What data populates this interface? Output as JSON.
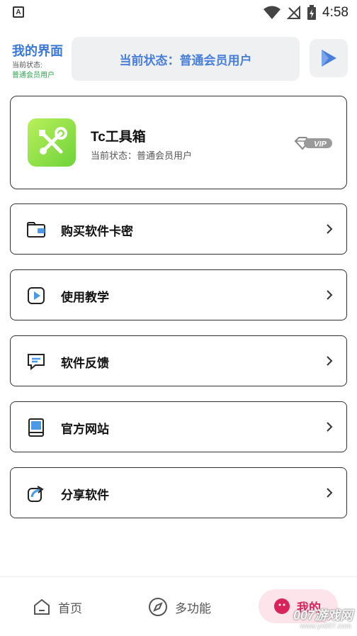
{
  "status_bar": {
    "time": "4:58",
    "left_icon": "A"
  },
  "header": {
    "title": "我的界面",
    "sub_label": "当前状态:",
    "sub_value": "普通会员用户",
    "status_text": "当前状态：普通会员用户",
    "play_icon": "play-icon",
    "accent": "#3a78d8"
  },
  "profile": {
    "app_name": "Tc工具箱",
    "status": "当前状态：普通会员用户",
    "badge": "VIP"
  },
  "menu": [
    {
      "label": "购买软件卡密",
      "icon": "wallet-icon"
    },
    {
      "label": "使用教学",
      "icon": "video-play-icon"
    },
    {
      "label": "软件反馈",
      "icon": "message-icon"
    },
    {
      "label": "官方网站",
      "icon": "book-icon"
    },
    {
      "label": "分享软件",
      "icon": "share-icon"
    }
  ],
  "bottom_nav": {
    "home": "首页",
    "multi": "多功能",
    "mine": "我的",
    "active_color": "#d8245a"
  },
  "watermark": {
    "main": "007游戏网",
    "url": "www.yx007.com"
  }
}
